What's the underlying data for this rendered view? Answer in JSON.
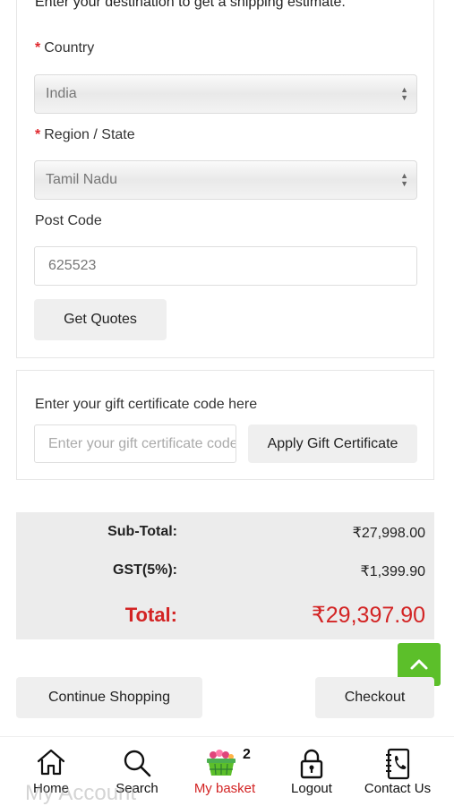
{
  "shipping": {
    "intro": "Enter your destination to get a shipping estimate.",
    "country_label": "Country",
    "country_value": "India",
    "region_label": "Region / State",
    "region_value": "Tamil Nadu",
    "postcode_label": "Post Code",
    "postcode_value": "625523",
    "get_quotes": "Get Quotes",
    "required_marker": "*"
  },
  "gift": {
    "label": "Enter your gift certificate code here",
    "placeholder": "Enter your gift certificate code",
    "apply": "Apply Gift Certificate"
  },
  "totals": {
    "subtotal_label": "Sub-Total:",
    "subtotal_value": "₹27,998.00",
    "gst_label": "GST(5%):",
    "gst_value": "₹1,399.90",
    "total_label": "Total:",
    "total_value": "₹29,397.90"
  },
  "actions": {
    "continue": "Continue Shopping",
    "checkout": "Checkout"
  },
  "nav": {
    "home": "Home",
    "search": "Search",
    "basket": "My basket",
    "basket_count": "2",
    "logout": "Logout",
    "contact": "Contact Us",
    "ghost_label": "My Account"
  },
  "colors": {
    "accent_red": "#d32424",
    "to_top_green": "#5cbf2a"
  },
  "icons": [
    "home-icon",
    "search-icon",
    "basket-icon",
    "lock-icon",
    "phone-book-icon",
    "chevron-up-icon"
  ]
}
